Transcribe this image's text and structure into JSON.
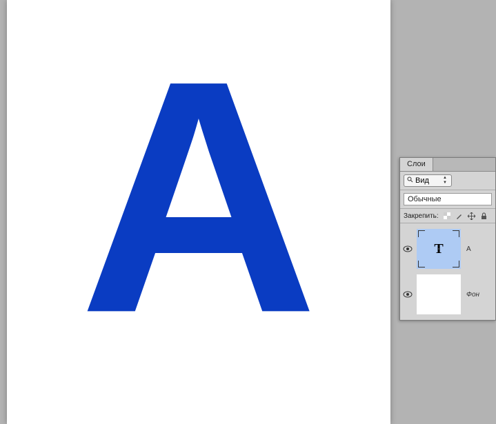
{
  "canvas": {
    "letter": "А",
    "color": "#0a3cc2"
  },
  "panel": {
    "tab": "Слои",
    "view_dropdown": "Вид",
    "mode_field": "Обычные",
    "lock_label": "Закрепить:",
    "layers": [
      {
        "name": "А",
        "type": "text",
        "visible": true,
        "selected": true
      },
      {
        "name": "Фон",
        "type": "background",
        "visible": true,
        "selected": false
      }
    ]
  }
}
